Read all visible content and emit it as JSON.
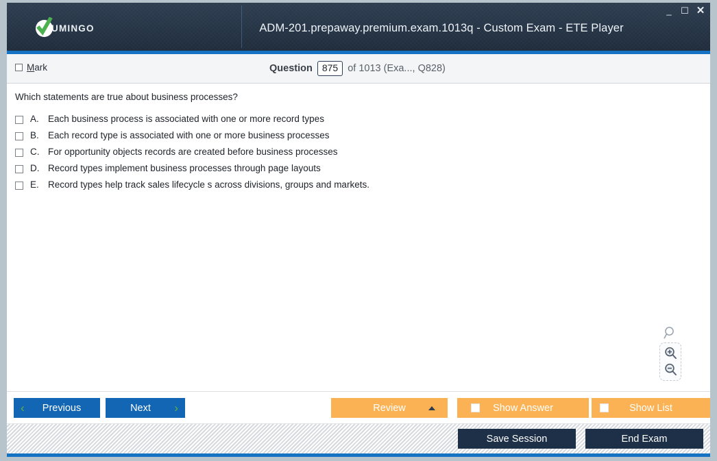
{
  "window": {
    "title": "ADM-201.prepaway.premium.exam.1013q - Custom Exam - ETE Player",
    "brand_name": "UMINGO",
    "controls": {
      "minimize": "_",
      "maximize": "☐",
      "close": "✕"
    },
    "accent_color": "#1673c4",
    "titlebar_color": "#27364a"
  },
  "question_bar": {
    "mark_label_accel": "M",
    "mark_label_rest": "ark",
    "question_word": "Question",
    "question_number": "875",
    "counter_tail": "of 1013 (Exa..., Q828)"
  },
  "content": {
    "question_text": "Which statements are true about business processes?",
    "options": [
      {
        "letter": "A.",
        "text": "Each business process is associated with one or more record types",
        "checked": false
      },
      {
        "letter": "B.",
        "text": "Each record type is associated with one or more business processes",
        "checked": false
      },
      {
        "letter": "C.",
        "text": "For opportunity objects records are created before business processes",
        "checked": false
      },
      {
        "letter": "D.",
        "text": "Record types implement business processes through page layouts",
        "checked": false
      },
      {
        "letter": "E.",
        "text": "Record types help track sales lifecycle s across divisions, groups and markets.",
        "checked": false
      }
    ]
  },
  "zoom_tools": {
    "magnifier_icon": "magnifier-icon",
    "zoom_in_icon": "zoom-in-icon",
    "zoom_out_icon": "zoom-out-icon"
  },
  "nav_bar": {
    "previous_label": "Previous",
    "next_label": "Next",
    "previous_chevron": "‹",
    "next_chevron": "›",
    "review_label": "Review",
    "show_answer_label": "Show Answer",
    "show_list_label": "Show List",
    "primary_color": "#1266b3",
    "chevron_color": "#62b43a",
    "orange_color": "#fbb254"
  },
  "status_bar": {
    "save_session_label": "Save Session",
    "end_exam_label": "End Exam",
    "dark_color": "#1d3048"
  }
}
